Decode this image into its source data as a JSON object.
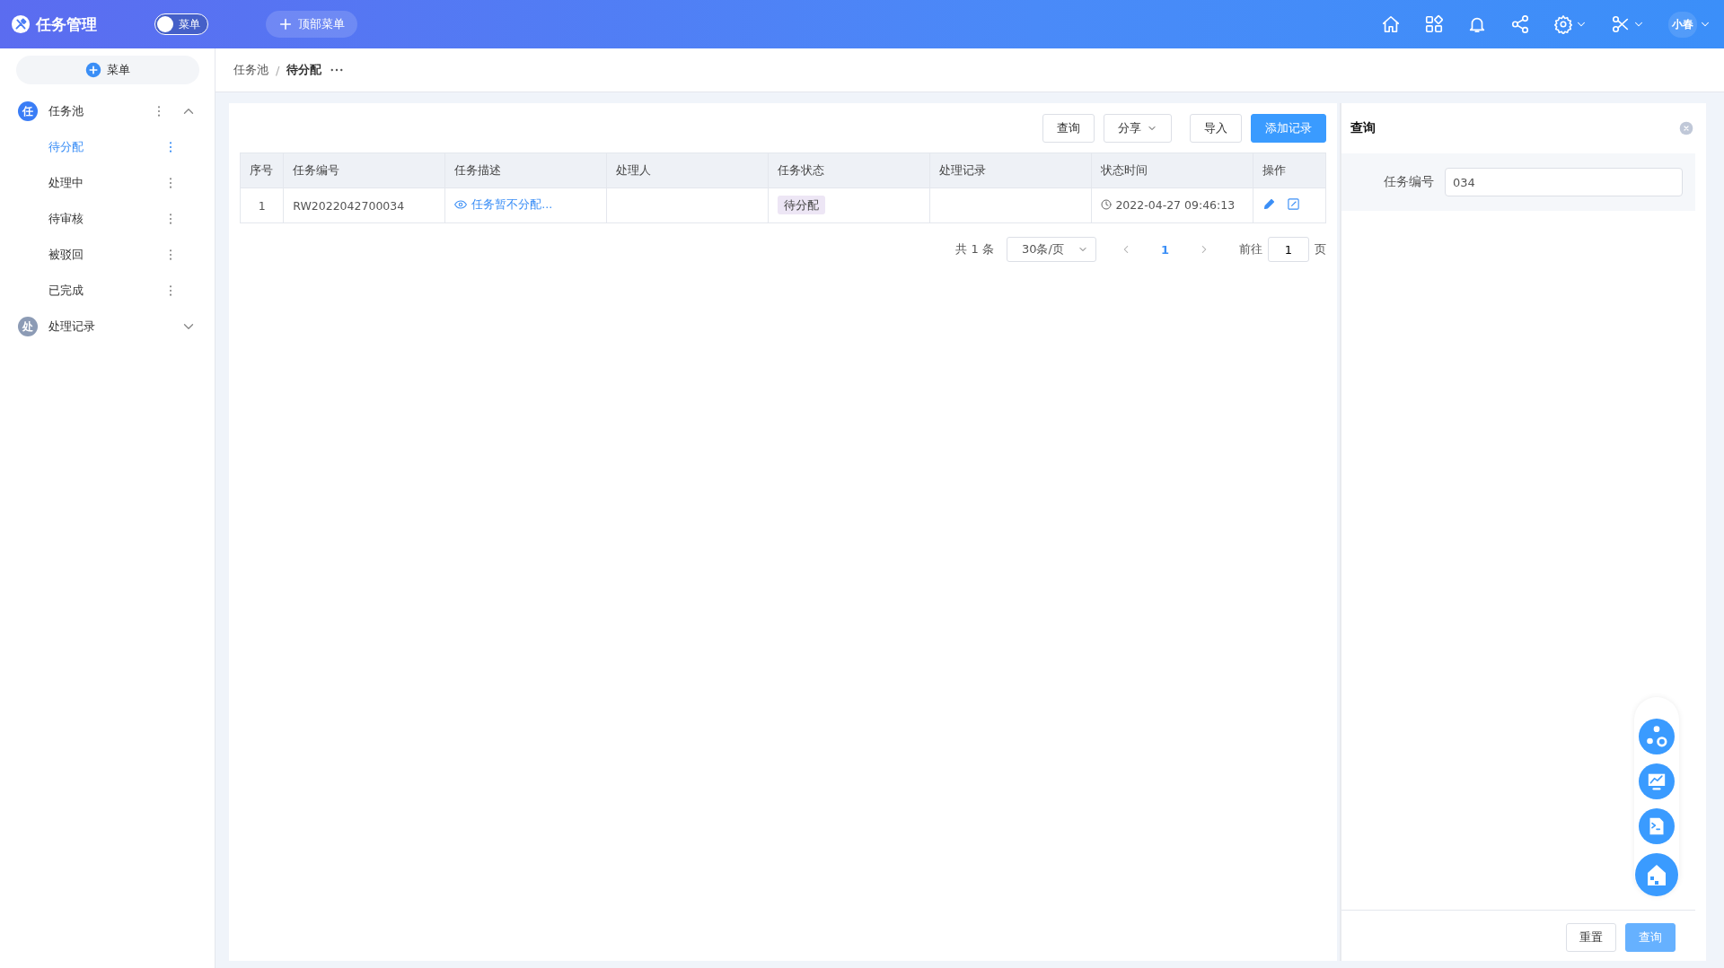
{
  "header": {
    "title": "任务管理",
    "menu_toggle": {
      "label": "菜单",
      "on": false
    },
    "top_menu_button": "顶部菜单",
    "user": "小春"
  },
  "sidebar": {
    "add_button": "菜单",
    "items": [
      {
        "avatar": "任",
        "label": "任务池",
        "active": true,
        "expanded": true,
        "children": [
          {
            "label": "待分配",
            "selected": true
          },
          {
            "label": "处理中",
            "selected": false
          },
          {
            "label": "待审核",
            "selected": false
          },
          {
            "label": "被驳回",
            "selected": false
          },
          {
            "label": "已完成",
            "selected": false
          }
        ]
      },
      {
        "avatar": "处",
        "label": "处理记录",
        "active": false,
        "expanded": false
      }
    ]
  },
  "breadcrumb": {
    "separator": "/",
    "items": [
      "任务池",
      "待分配"
    ]
  },
  "toolbar": [
    {
      "label": "查询",
      "kind": "plain"
    },
    {
      "label": "分享",
      "kind": "dropdown"
    },
    {
      "label": "导入",
      "kind": "plain"
    },
    {
      "label": "添加记录",
      "kind": "primary"
    }
  ],
  "table": {
    "columns": [
      "序号",
      "任务编号",
      "任务描述",
      "处理人",
      "任务状态",
      "处理记录",
      "状态时间",
      "操作"
    ],
    "rows": [
      {
        "index": "1",
        "task_no": "RW2022042700034",
        "description": "任务暂不分配...",
        "handler": "",
        "status": "待分配",
        "record": "",
        "time": "2022-04-27 09:46:13"
      }
    ]
  },
  "pagination": {
    "total": "共 1 条",
    "page_size": "30条/页",
    "pages": [
      {
        "label": "1",
        "selected": true
      }
    ],
    "goto_label": "前往",
    "goto_value": "1",
    "goto_suffix": "页"
  },
  "query_panel": {
    "title": "查询",
    "fields": [
      {
        "label": "任务编号",
        "value": "034"
      }
    ],
    "buttons": [
      {
        "label": "重置",
        "kind": "plain"
      },
      {
        "label": "查询",
        "kind": "primary"
      }
    ]
  }
}
